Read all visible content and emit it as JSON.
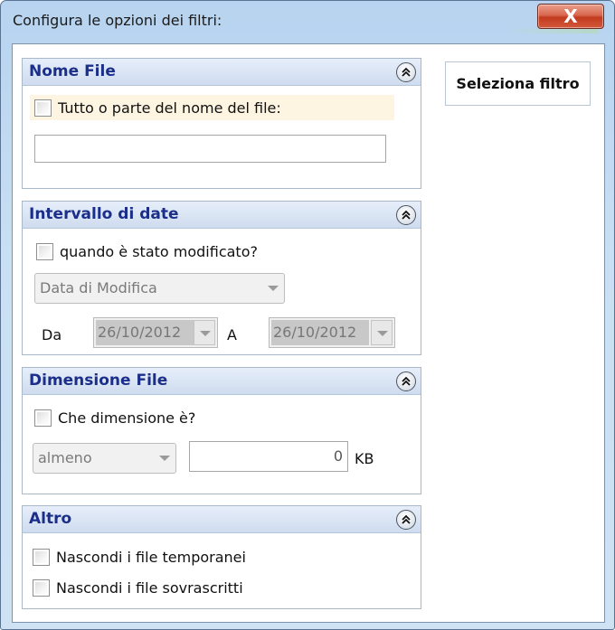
{
  "window": {
    "title": "Configura le opzioni dei filtri:",
    "close_symbol": "X"
  },
  "sidebar_button": {
    "label": "Seleziona filtro"
  },
  "panels": {
    "nome_file": {
      "title": "Nome File",
      "checkbox_label": "Tutto o parte del nome del file:",
      "checked": false,
      "name_value": ""
    },
    "intervallo_date": {
      "title": "Intervallo di date",
      "checkbox_label": "quando è stato modificato?",
      "checked": false,
      "combo_value": "Data di Modifica",
      "from_label": "Da",
      "from_date": "26/10/2012",
      "to_label": "A",
      "to_date": "26/10/2012"
    },
    "dimensione_file": {
      "title": "Dimensione File",
      "checkbox_label": "Che dimensione è?",
      "checked": false,
      "combo_value": "almeno",
      "size_value": "0",
      "unit": "KB"
    },
    "altro": {
      "title": "Altro",
      "options": [
        {
          "label": "Nascondi i file temporanei",
          "checked": false
        },
        {
          "label": "Nascondi i file sovrascritti",
          "checked": false
        }
      ]
    }
  },
  "icons": {
    "collapse": "double-chevron-up-icon",
    "close": "close-icon",
    "dropdown": "chevron-down-icon"
  },
  "colors": {
    "panel_title": "#1b2f8a",
    "frame": "#c9dff3",
    "close_button": "#c23b1f",
    "highlight": "#fdf4e2"
  }
}
